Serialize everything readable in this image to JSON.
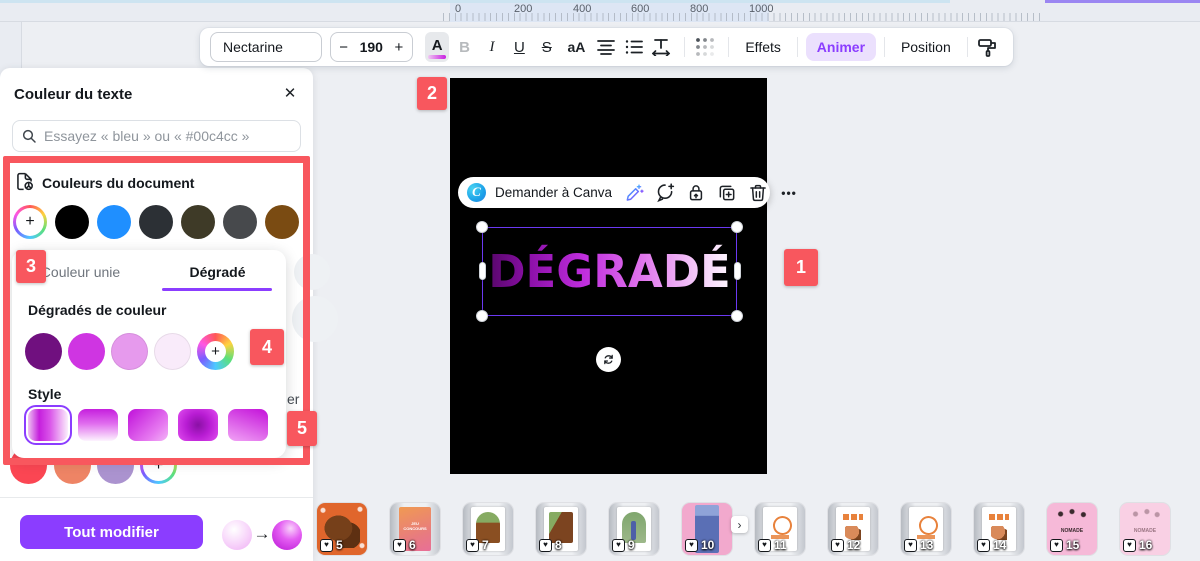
{
  "colors": {
    "accent_purple": "#8b3dff",
    "animer_bg": "#ebe0fd",
    "annotation_red": "#f8575e",
    "selection_purple": "#6b39f2",
    "button_purple": "#8b3dff"
  },
  "ruler": {
    "ticks": [
      "0",
      "200",
      "400",
      "600",
      "800",
      "1000"
    ]
  },
  "toolbar": {
    "font_name": "Nectarine",
    "size_value": "190",
    "minus": "−",
    "plus": "+",
    "color_letter": "A",
    "bold": "B",
    "italic": "I",
    "underline": "U",
    "strikethrough": "S",
    "case": "aA",
    "effects": "Effets",
    "animate": "Animer",
    "position": "Position"
  },
  "panel": {
    "title": "Couleur du texte",
    "close": "✕",
    "search_placeholder": "Essayez « bleu » ou « #00c4cc »",
    "document_colors_label": "Couleurs du document",
    "document_colors": [
      "#000000",
      "#1f8fff",
      "#2c3035",
      "#3e3a27",
      "#47494c",
      "#7a4b12"
    ],
    "tab_solid": "Couleur unie",
    "tab_gradient": "Dégradé",
    "gradients_label": "Dégradés de couleur",
    "gradient_swatches": [
      "#70107f",
      "#cf35e2",
      "#e69aed",
      "#f9ebfa"
    ],
    "style_label": "Style",
    "cutoff_text": "er",
    "default_colors": [
      "#fb4653",
      "#ee8465",
      "#ab93cf"
    ],
    "apply_all_label": "Tout modifier",
    "arrow": "→"
  },
  "context_toolbar": {
    "ask_canva": "Demander à Canva",
    "more": "•••"
  },
  "canvas": {
    "text": "DÉGRADÉ"
  },
  "annotations": {
    "n1": "1",
    "n2": "2",
    "n3": "3",
    "n4": "4",
    "n5": "5"
  },
  "filmstrip": {
    "expand": "›",
    "heart": "♥",
    "pages": [
      {
        "num": "5"
      },
      {
        "num": "6",
        "caption": "JEU CONCOURS"
      },
      {
        "num": "7"
      },
      {
        "num": "8"
      },
      {
        "num": "9"
      },
      {
        "num": "10"
      },
      {
        "num": "11"
      },
      {
        "num": "12"
      },
      {
        "num": "13"
      },
      {
        "num": "14"
      },
      {
        "num": "15",
        "caption": "NOMADE"
      },
      {
        "num": "16",
        "caption": "NOMADE"
      }
    ]
  }
}
